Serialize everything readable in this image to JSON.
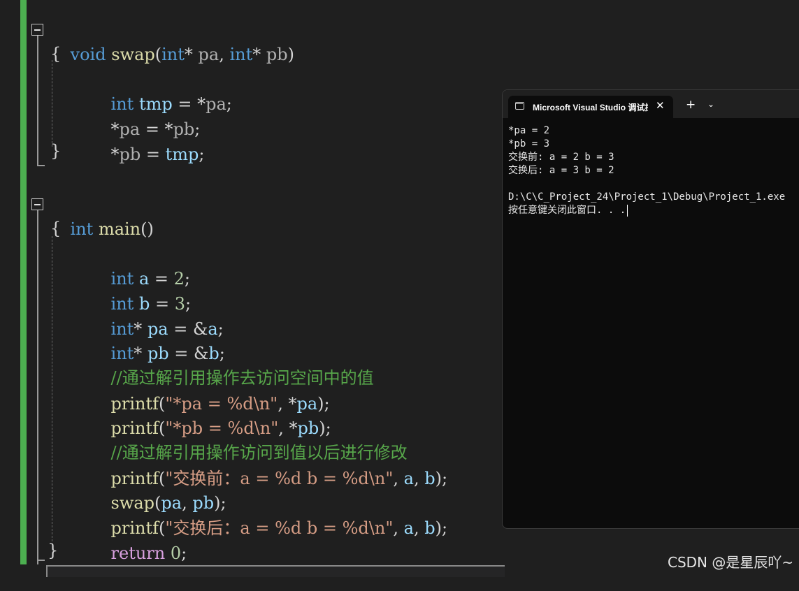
{
  "editor": {
    "lines": {
      "l1": {
        "t1": "void",
        "t2": " ",
        "t3": "swap",
        "t4": "(",
        "t5": "int",
        "t6": "* ",
        "t7": "pa",
        "t8": ", ",
        "t9": "int",
        "t10": "* ",
        "t11": "pb",
        "t12": ")"
      },
      "l2": {
        "t1": "{"
      },
      "l3": {
        "t1": "int",
        "t2": " ",
        "t3": "tmp",
        "t4": " = *",
        "t5": "pa",
        "t6": ";"
      },
      "l4": {
        "t1": "*",
        "t2": "pa",
        "t3": " = *",
        "t4": "pb",
        "t5": ";"
      },
      "l5": {
        "t1": "*",
        "t2": "pb",
        "t3": " = ",
        "t4": "tmp",
        "t5": ";"
      },
      "l6": {
        "t1": "}"
      },
      "l7": {
        "t1": "int",
        "t2": " ",
        "t3": "main",
        "t4": "()"
      },
      "l8": {
        "t1": "{"
      },
      "l9": {
        "t1": "int",
        "t2": " ",
        "t3": "a",
        "t4": " = ",
        "t5": "2",
        "t6": ";"
      },
      "l10": {
        "t1": "int",
        "t2": " ",
        "t3": "b",
        "t4": " = ",
        "t5": "3",
        "t6": ";"
      },
      "l11": {
        "t1": "int",
        "t2": "* ",
        "t3": "pa",
        "t4": " = &",
        "t5": "a",
        "t6": ";"
      },
      "l12": {
        "t1": "int",
        "t2": "* ",
        "t3": "pb",
        "t4": " = &",
        "t5": "b",
        "t6": ";"
      },
      "l13": {
        "t1": "//通过解引用操作去访问空间中的值"
      },
      "l14": {
        "t1": "printf",
        "t2": "(",
        "t3": "\"*pa = %d\\n\"",
        "t4": ", *",
        "t5": "pa",
        "t6": ");"
      },
      "l15": {
        "t1": "printf",
        "t2": "(",
        "t3": "\"*pb = %d\\n\"",
        "t4": ", *",
        "t5": "pb",
        "t6": ");"
      },
      "l16": {
        "t1": "//通过解引用操作访问到值以后进行修改"
      },
      "l17": {
        "t1": "printf",
        "t2": "(",
        "t3": "\"交换前：a = %d b = %d\\n\"",
        "t4": ", ",
        "t5": "a",
        "t6": ", ",
        "t7": "b",
        "t8": ");"
      },
      "l18": {
        "t1": "swap",
        "t2": "(",
        "t3": "pa",
        "t4": ", ",
        "t5": "pb",
        "t6": ");"
      },
      "l19": {
        "t1": "printf",
        "t2": "(",
        "t3": "\"交换后：a = %d b = %d\\n\"",
        "t4": ", ",
        "t5": "a",
        "t6": ", ",
        "t7": "b",
        "t8": ");"
      },
      "l20": {
        "t1": "return",
        "t2": " ",
        "t3": "0",
        "t4": ";"
      },
      "l21": {
        "t1": "}"
      }
    }
  },
  "console": {
    "tab_title": "Microsoft Visual Studio 调试控制台",
    "close_glyph": "✕",
    "new_tab_glyph": "+",
    "dropdown_glyph": "⌄",
    "output": [
      "*pa = 2",
      "*pb = 3",
      "交换前: a = 2 b = 3",
      "交换后: a = 3 b = 2",
      "",
      "D:\\C\\C_Project_24\\Project_1\\Debug\\Project_1.exe",
      "按任意键关闭此窗口. . ."
    ]
  },
  "watermark": "CSDN @是星辰吖~",
  "colors": {
    "editor_bg": "#1f1f1f",
    "keyword": "#569cd6",
    "control_keyword": "#d8a0df",
    "function": "#dcdcaa",
    "variable": "#9cdcfe",
    "number": "#b5cea8",
    "string": "#d69d85",
    "comment": "#57a64a",
    "change_bar": "#4caf50",
    "console_bg": "#0c0c0c"
  }
}
